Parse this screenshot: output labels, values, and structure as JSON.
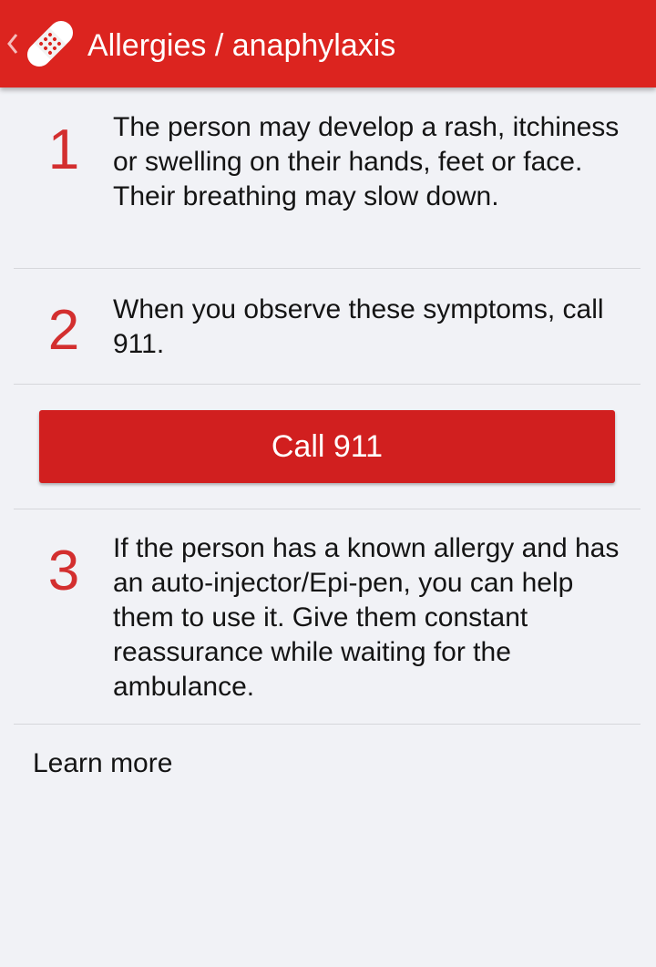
{
  "header": {
    "back_icon": "chevron-left-icon",
    "app_icon": "bandage-icon",
    "title": "Allergies / anaphylaxis",
    "color": "#dc241f"
  },
  "steps": [
    {
      "number": "1",
      "text": "The person may develop a rash, itchiness or swelling on their hands, feet or face. Their breathing may slow down."
    },
    {
      "number": "2",
      "text": "When you observe these symptoms, call 911."
    },
    {
      "number": "3",
      "text": "If the person has a known allergy and has an auto-injector/Epi-pen, you can help them to use it. Give them constant reassurance while waiting for the ambulance."
    }
  ],
  "call_button": {
    "label": "Call 911",
    "color": "#d11f1f"
  },
  "learn_more": {
    "label": "Learn more"
  },
  "colors": {
    "background": "#f1f2f6",
    "step_number": "#d32f2f"
  }
}
